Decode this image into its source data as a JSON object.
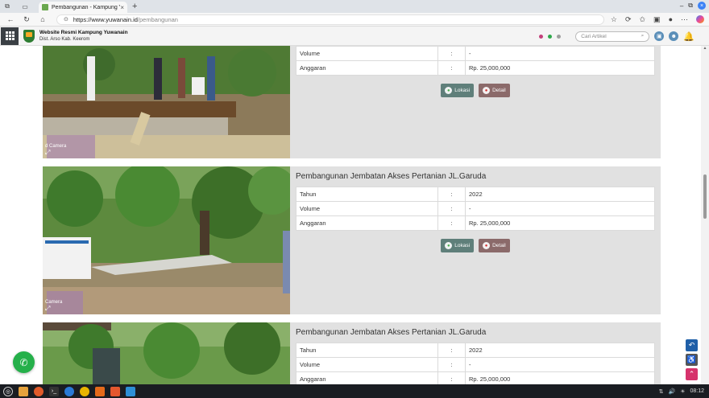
{
  "browser": {
    "tab_title": "Pembangunan - Kampung Yuw",
    "tab_close": "×",
    "new_tab": "+",
    "url_host": "https://www.yuwanain.id",
    "url_path": "/pembangunan",
    "lock_glyph": "⊙"
  },
  "site": {
    "title": "Website Resmi Kampung Yuwanain",
    "subtitle": "Dist. Arso Kab. Keerom",
    "search_placeholder": "Cari Artikel",
    "dots": [
      "#c2407a",
      "#2ea84a",
      "#9e9e9e"
    ]
  },
  "cards": [
    {
      "title": "",
      "rows": [
        {
          "key": "Volume",
          "sep": ":",
          "value": "-"
        },
        {
          "key": "Anggaran",
          "sep": ":",
          "value": "Rp. 25,000,000"
        }
      ],
      "lokasi": "Lokasi",
      "detail": "Detail",
      "watermark": "d Camera"
    },
    {
      "title": "Pembangunan Jembatan Akses Pertanian JL.Garuda",
      "rows": [
        {
          "key": "Tahun",
          "sep": ":",
          "value": "2022"
        },
        {
          "key": "Volume",
          "sep": ":",
          "value": "-"
        },
        {
          "key": "Anggaran",
          "sep": ":",
          "value": "Rp. 25,000,000"
        }
      ],
      "lokasi": "Lokasi",
      "detail": "Detail",
      "watermark": "Camera"
    },
    {
      "title": "Pembangunan Jembatan Akses Pertanian JL.Garuda",
      "rows": [
        {
          "key": "Tahun",
          "sep": ":",
          "value": "2022"
        },
        {
          "key": "Volume",
          "sep": ":",
          "value": "-"
        },
        {
          "key": "Anggaran",
          "sep": ":",
          "value": "Rp. 25,000,000"
        }
      ]
    }
  ],
  "taskbar": {
    "clock": "08:12"
  }
}
